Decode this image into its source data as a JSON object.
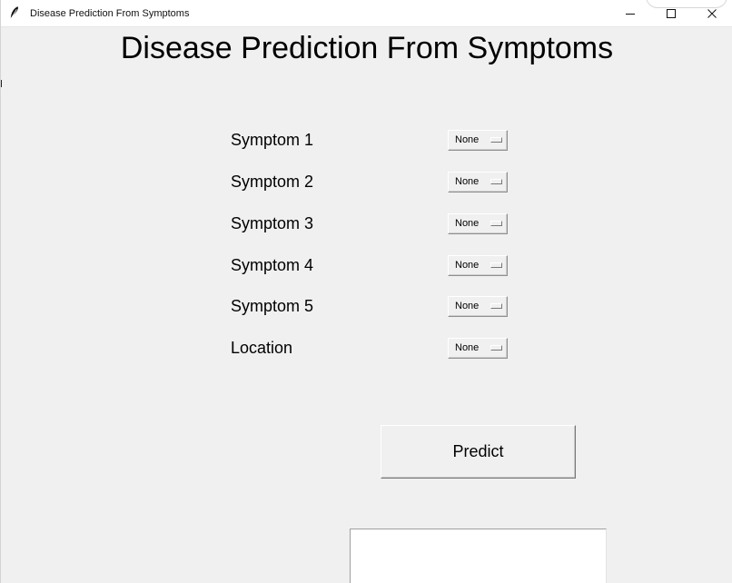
{
  "window": {
    "title": "Disease Prediction From Symptoms"
  },
  "app": {
    "heading": "Disease Prediction From Symptoms",
    "fields": [
      {
        "label": "Symptom 1",
        "value": "None"
      },
      {
        "label": "Symptom 2",
        "value": "None"
      },
      {
        "label": "Symptom 3",
        "value": "None"
      },
      {
        "label": "Symptom 4",
        "value": "None"
      },
      {
        "label": "Symptom 5",
        "value": "None"
      },
      {
        "label": "Location",
        "value": "None"
      }
    ],
    "predict_label": "Predict",
    "output_text": ""
  },
  "icons": {
    "app": "feather-icon",
    "minimize": "minimize-icon",
    "maximize": "maximize-icon",
    "close": "close-icon"
  },
  "colors": {
    "background": "#f0f0f0",
    "titlebar": "#ffffff",
    "text": "#000000",
    "output_background": "#ffffff"
  }
}
